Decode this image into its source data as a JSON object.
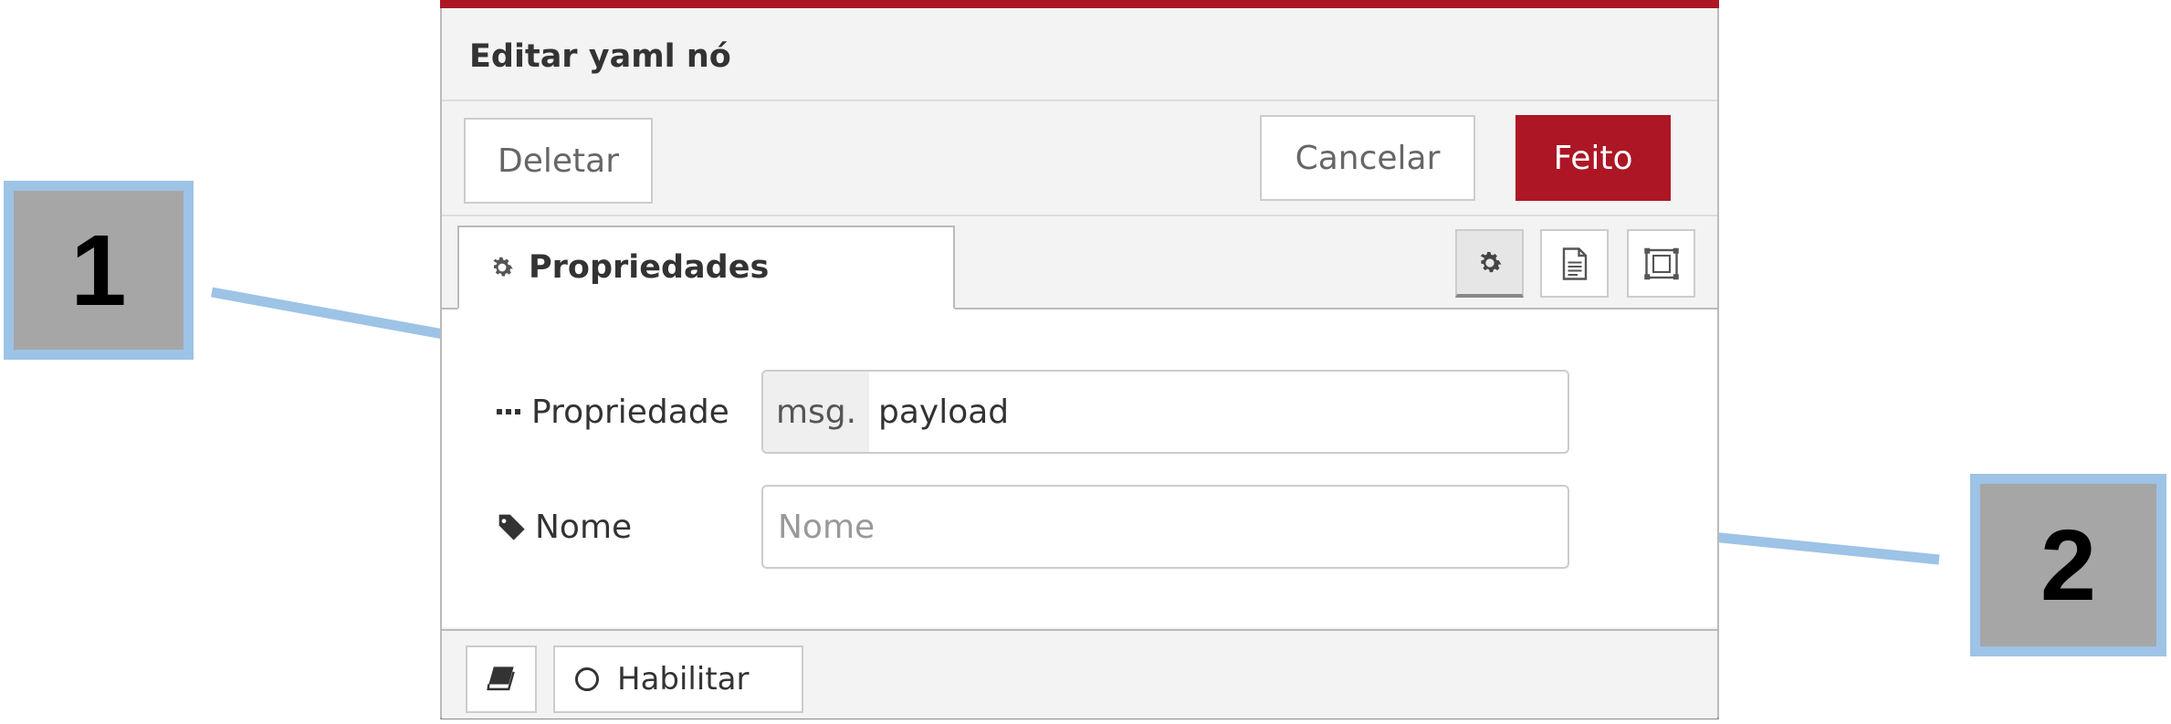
{
  "tray": {
    "title": "Editar yaml nó",
    "buttons": {
      "delete_label": "Deletar",
      "cancel_label": "Cancelar",
      "done_label": "Feito"
    },
    "tabs": [
      {
        "label": "Propriedades",
        "icon": "cog-icon",
        "active": true
      }
    ],
    "tab_icons": [
      "cog-icon",
      "file-text-icon",
      "frame-icon"
    ]
  },
  "form": {
    "property": {
      "label": "Propriedade",
      "icon": "ellipsis-icon",
      "type_prefix": "msg.",
      "value": "payload"
    },
    "name": {
      "label": "Nome",
      "icon": "tag-icon",
      "placeholder": "Nome",
      "value": ""
    }
  },
  "footer": {
    "book_icon": "book-icon",
    "enable_label": "Habilitar"
  },
  "callouts": {
    "one": "1",
    "two": "2"
  },
  "colors": {
    "accent_red": "#ad1625",
    "callout_fill": "#a6a6a6",
    "callout_border": "#9dc3e6"
  }
}
